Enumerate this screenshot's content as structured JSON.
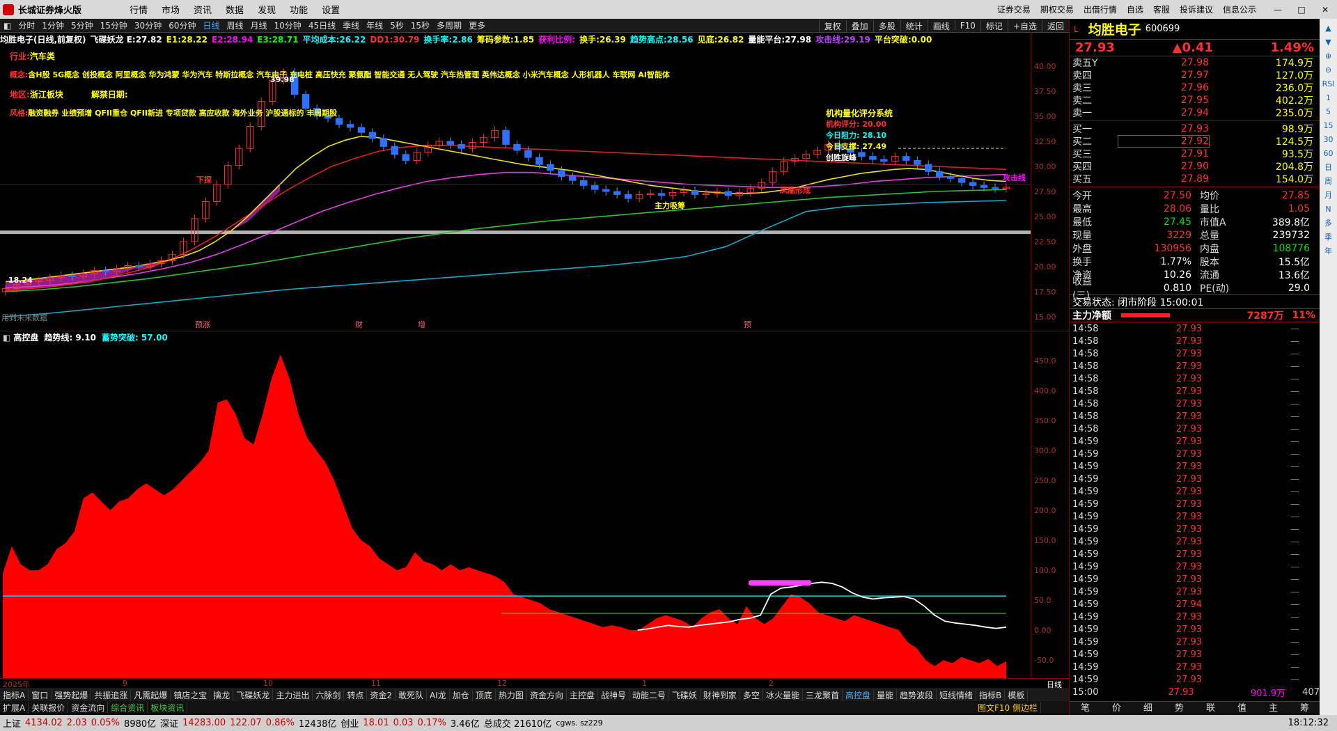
{
  "app": {
    "title": "长城证券烽火版",
    "menu": [
      "行情",
      "市场",
      "资讯",
      "数据",
      "发现",
      "功能",
      "设置"
    ],
    "right_menu": [
      "证券交易",
      "期权交易",
      "出借行情",
      "自选",
      "客服",
      "投诉建议",
      "信息公示"
    ]
  },
  "periods": {
    "items": [
      "分时",
      "1分钟",
      "5分钟",
      "15分钟",
      "30分钟",
      "60分钟",
      "日线",
      "周线",
      "月线",
      "10分钟",
      "45日线",
      "季线",
      "年线",
      "5秒",
      "15秒",
      "多周期",
      "更多"
    ],
    "active": "日线",
    "tools": [
      "复权",
      "叠加",
      "多股",
      "统计",
      "画线",
      "F10",
      "标记",
      "+自选",
      "返回"
    ]
  },
  "main_info": [
    {
      "t": "均胜电子(日线,前复权)",
      "c": "#fff"
    },
    {
      "t": "飞碟妖龙 E:27.82",
      "c": "#fff"
    },
    {
      "t": "E1:28.22",
      "c": "#ff0"
    },
    {
      "t": "E2:28.94",
      "c": "#f0f"
    },
    {
      "t": "E3:28.71",
      "c": "#0f0"
    },
    {
      "t": "平均成本:26.22",
      "c": "#0ff"
    },
    {
      "t": "DD1:30.79",
      "c": "#ff3030"
    },
    {
      "t": "换手率:2.86",
      "c": "#0ff"
    },
    {
      "t": "筹码参数:1.85",
      "c": "#ff0"
    },
    {
      "t": "获利比例:",
      "c": "#f0f"
    },
    {
      "t": "换手:26.39",
      "c": "#ff0"
    },
    {
      "t": "趋势高点:28.56",
      "c": "#0ff"
    },
    {
      "t": "见底:26.82",
      "c": "#ff0"
    },
    {
      "t": "量能平台:27.98",
      "c": "#fff"
    },
    {
      "t": "攻击线:29.19",
      "c": "#c040ff"
    },
    {
      "t": "平台突破:0.00",
      "c": "#ff0"
    }
  ],
  "overlays": {
    "industry": {
      "label": "行业:",
      "value": "汽车类"
    },
    "concept": {
      "label": "概念:",
      "value": "含H股 5G概念 创投概念 阿里概念 华为鸿蒙 华为汽车 特斯拉概念 汽车电子 充电桩 高压快充 聚氨酯 智能交通 无人驾驶 汽车热管理 英伟达概念 小米汽车概念 人形机器人 车联网 AI智能体"
    },
    "region": {
      "label": "地区:",
      "value": "浙江板块",
      "unlock": "解禁日期:"
    },
    "style": {
      "label": "风格:",
      "value": "融资融券 业绩预增 QFII重仓 QFII新进 专项贷款 高应收款 海外业务 沪股通标的 丰周期股"
    },
    "quant_title": "机构量化评分系统",
    "quant_score": "机构评分: 20.00",
    "quant_res": "今日阻力: 28.10",
    "quant_sup": "今日支撑: 27.49",
    "quant_note": "创胜旋峰",
    "label_high": "39.98",
    "label_low": "18.24",
    "label_attack": "攻击线",
    "label_force": "主力吸筹",
    "label_fenglian": "凤凰形成",
    "label_xiatan": "下探",
    "label_fut": "用到未来数据"
  },
  "y_axis_main": [
    "40.00",
    "37.50",
    "35.00",
    "32.50",
    "30.00",
    "27.50",
    "25.00",
    "22.50",
    "20.00",
    "17.50",
    "15.00"
  ],
  "y_axis_sub": [
    "450.0",
    "400.0",
    "350.0",
    "300.0",
    "250.0",
    "200.0",
    "150.0",
    "100.0",
    "50.0",
    "0.00",
    "-50.0"
  ],
  "event_marks": [
    {
      "t": "预涨",
      "x": 280
    },
    {
      "t": "财",
      "x": 510
    },
    {
      "t": "增",
      "x": 600
    },
    {
      "t": "预",
      "x": 1068
    }
  ],
  "sub_info": [
    {
      "t": "高控盘",
      "c": "#fff"
    },
    {
      "t": "趋势线: 9.10",
      "c": "#fff"
    },
    {
      "t": "蓄势突破: 57.00",
      "c": "#0ff"
    }
  ],
  "x_axis": {
    "labels": [
      {
        "t": "2025年",
        "x": 4
      },
      {
        "t": "9",
        "x": 176
      },
      {
        "t": "10",
        "x": 378
      },
      {
        "t": "11",
        "x": 533
      },
      {
        "t": "12",
        "x": 714
      },
      {
        "t": "1",
        "x": 922
      },
      {
        "t": "2",
        "x": 1104
      }
    ],
    "cycle": "日线"
  },
  "indicator_tabs": [
    "指标A",
    "窗口",
    "强势起爆",
    "共振追涨",
    "凡需起爆",
    "镇店之宝",
    "擒龙",
    "飞碟妖龙",
    "主力进出",
    "六脉剑",
    "转点",
    "资金2",
    "敢死队",
    "AI龙",
    "加仓",
    "顶底",
    "热力图",
    "资金方向",
    "主控盘",
    "战神号",
    "动能二号",
    "飞碟妖",
    "财神到家",
    "多空",
    "冰火量能",
    "三龙聚首",
    "高控盘",
    "量能",
    "趋势波段",
    "短线情绪",
    "指标B",
    "模板"
  ],
  "active_tab": "高控盘",
  "bottom_tabs": [
    "扩展A",
    "关联报价",
    "资金流向",
    "综合资讯",
    "板块资讯"
  ],
  "bottom_note": "图文F10 侧边栏",
  "status": {
    "sh_label": "上证",
    "sh": "4134.02",
    "sh_chg": "2.03",
    "sh_pct": "0.05%",
    "sh_amt": "8980亿",
    "sz_label": "深证",
    "sz": "14283.00",
    "sz_chg": "122.07",
    "sz_pct": "0.86%",
    "sz_amt": "12438亿",
    "cy_label": "创业",
    "cy": "18.01",
    "cy_chg": "0.03",
    "cy_pct": "0.17%",
    "cy_amt": "3.46亿",
    "total": "总成交 21610亿",
    "server": "cgws. sz229",
    "clock": "18:12:32"
  },
  "quote": {
    "name": "均胜电子",
    "code": "600699",
    "price": "27.93",
    "change": "▲0.41",
    "pct": "1.49%",
    "asks": [
      {
        "l": "卖五Y",
        "p": "27.98",
        "v": "174.9万"
      },
      {
        "l": "卖四",
        "p": "27.97",
        "v": "127.0万"
      },
      {
        "l": "卖三",
        "p": "27.96",
        "v": "236.0万"
      },
      {
        "l": "卖二",
        "p": "27.95",
        "v": "402.2万"
      },
      {
        "l": "卖一",
        "p": "27.94",
        "v": "235.0万"
      }
    ],
    "bids": [
      {
        "l": "买一",
        "p": "27.93",
        "v": "98.9万"
      },
      {
        "l": "买二",
        "p": "27.92",
        "v": "124.5万"
      },
      {
        "l": "买三",
        "p": "27.91",
        "v": "93.5万"
      },
      {
        "l": "买四",
        "p": "27.90",
        "v": "204.8万"
      },
      {
        "l": "买五",
        "p": "27.89",
        "v": "154.0万"
      }
    ],
    "stats": [
      {
        "a": "今开",
        "b": "27.50",
        "bc": "red",
        "c": "均价",
        "d": "27.85",
        "dc": "red"
      },
      {
        "a": "最高",
        "b": "28.06",
        "bc": "red",
        "c": "量比",
        "d": "1.05",
        "dc": "red"
      },
      {
        "a": "最低",
        "b": "27.45",
        "bc": "grn",
        "c": "市值A",
        "d": "389.8亿",
        "dc": "wht"
      },
      {
        "a": "现量",
        "b": "3229",
        "bc": "red",
        "c": "总量",
        "d": "239732",
        "dc": "wht"
      },
      {
        "a": "外盘",
        "b": "130956",
        "bc": "red",
        "c": "内盘",
        "d": "108776",
        "dc": "grn"
      },
      {
        "a": "换手",
        "b": "1.77%",
        "bc": "wht",
        "c": "股本",
        "d": "15.5亿",
        "dc": "wht"
      },
      {
        "a": "净资",
        "b": "10.26",
        "bc": "wht",
        "c": "流通",
        "d": "13.6亿",
        "dc": "wht"
      },
      {
        "a": "收益(三)",
        "b": "0.810",
        "bc": "wht",
        "c": "PE(动)",
        "d": "29.0",
        "dc": "wht"
      }
    ],
    "trade_state": "交易状态: 闭市阶段 15:00:01",
    "flow_label": "主力净额",
    "flow_value": "7287万",
    "flow_pct": "11%",
    "ticks": [
      {
        "t": "14:58",
        "p": "27.93"
      },
      {
        "t": "14:58",
        "p": "27.93"
      },
      {
        "t": "14:58",
        "p": "27.93"
      },
      {
        "t": "14:58",
        "p": "27.93"
      },
      {
        "t": "14:58",
        "p": "27.93"
      },
      {
        "t": "14:58",
        "p": "27.93"
      },
      {
        "t": "14:58",
        "p": "27.93"
      },
      {
        "t": "14:58",
        "p": "27.93"
      },
      {
        "t": "14:58",
        "p": "27.93"
      },
      {
        "t": "14:59",
        "p": "27.93"
      },
      {
        "t": "14:59",
        "p": "27.93"
      },
      {
        "t": "14:59",
        "p": "27.93"
      },
      {
        "t": "14:59",
        "p": "27.93"
      },
      {
        "t": "14:59",
        "p": "27.93"
      },
      {
        "t": "14:59",
        "p": "27.93"
      },
      {
        "t": "14:59",
        "p": "27.93"
      },
      {
        "t": "14:59",
        "p": "27.93"
      },
      {
        "t": "14:59",
        "p": "27.93"
      },
      {
        "t": "14:59",
        "p": "27.93"
      },
      {
        "t": "14:59",
        "p": "27.93"
      },
      {
        "t": "14:59",
        "p": "27.93"
      },
      {
        "t": "14:59",
        "p": "27.93"
      },
      {
        "t": "14:59",
        "p": "27.94"
      },
      {
        "t": "14:59",
        "p": "27.93"
      },
      {
        "t": "14:59",
        "p": "27.93"
      },
      {
        "t": "14:59",
        "p": "27.93"
      },
      {
        "t": "14:59",
        "p": "27.93"
      },
      {
        "t": "14:59",
        "p": "27.93"
      },
      {
        "t": "14:59",
        "p": "27.93"
      },
      {
        "t": "15:00",
        "p": "27.93",
        "v": "901.9万",
        "n": "407"
      }
    ],
    "tabs": [
      "笔",
      "价",
      "细",
      "势",
      "联",
      "值",
      "主",
      "筹"
    ]
  },
  "sidebar": [
    "▲",
    "▼",
    "⊕",
    "⊖",
    "RSI",
    "1",
    "5",
    "15",
    "30",
    "60",
    "日",
    "周",
    "月",
    "N",
    "多",
    "季",
    "年"
  ],
  "chart_data": [
    {
      "type": "line",
      "name": "K线(日线)",
      "ylim": [
        15,
        41
      ],
      "close": [
        17.8,
        18.2,
        18.5,
        18.6,
        18.9,
        19.1,
        19.0,
        19.3,
        19.6,
        19.5,
        19.8,
        20.1,
        20.0,
        20.3,
        20.6,
        21.2,
        22.5,
        24.8,
        26.5,
        28.2,
        30.1,
        31.8,
        34.0,
        36.5,
        38.6,
        39.4,
        37.2,
        35.8,
        35.1,
        34.8,
        34.2,
        33.9,
        33.4,
        32.8,
        32.0,
        31.2,
        30.6,
        31.4,
        32.1,
        32.5,
        32.2,
        31.8,
        32.4,
        32.9,
        33.6,
        32.2,
        31.6,
        30.9,
        30.2,
        29.6,
        29.0,
        28.6,
        28.1,
        27.7,
        27.5,
        27.2,
        26.8,
        27.2,
        27.3,
        27.1,
        27.4,
        27.6,
        27.2,
        27.3,
        27.5,
        27.1,
        27.4,
        27.8,
        28.4,
        29.5,
        30.5,
        30.8,
        31.2,
        31.6,
        32.2,
        31.8,
        31.4,
        31.0,
        30.7,
        30.5,
        31.0,
        30.6,
        30.2,
        29.5,
        29.0,
        28.8,
        28.4,
        28.1,
        27.9,
        27.8,
        27.93
      ],
      "ma_yellow": [
        18.5,
        18.6,
        18.8,
        19.0,
        19.2,
        19.4,
        19.6,
        19.8,
        20.0,
        20.3,
        20.6,
        21.0,
        21.6,
        22.5,
        23.6,
        25.0,
        26.6,
        28.2,
        29.8,
        31.0,
        32.0,
        32.6,
        33.0,
        32.9,
        32.6,
        32.3,
        32.0,
        31.7,
        31.4,
        31.1,
        30.8,
        30.5,
        30.2,
        30.0,
        29.8,
        29.6,
        29.3,
        29.0,
        28.7,
        28.4,
        28.1,
        27.9,
        27.7,
        27.5,
        27.4,
        27.3,
        27.3,
        27.4,
        27.6,
        27.9,
        28.3,
        28.7,
        29.0,
        29.3,
        29.5,
        29.7,
        29.8,
        29.7,
        29.4,
        29.1,
        28.8,
        28.6,
        28.5
      ],
      "ma_red": [
        17.6,
        17.8,
        18.0,
        18.3,
        18.7,
        19.2,
        19.8,
        20.6,
        21.7,
        23.0,
        24.5,
        26.0,
        27.5,
        28.8,
        30.0,
        30.8,
        31.5,
        31.9,
        32.1,
        32.1,
        32.0,
        31.9,
        31.8,
        31.7,
        31.6,
        31.5,
        31.4,
        31.3,
        31.2,
        31.1,
        31.0,
        30.9,
        30.8,
        30.7,
        30.6,
        30.5,
        30.4,
        30.3,
        30.2,
        30.1,
        30.0,
        29.9,
        29.8,
        29.7
      ],
      "ma_magenta": [
        17.9,
        18.0,
        18.2,
        18.5,
        18.9,
        19.3,
        19.8,
        20.4,
        21.2,
        22.2,
        23.3,
        24.4,
        25.5,
        26.4,
        27.2,
        27.9,
        28.5,
        28.9,
        29.2,
        29.4,
        29.4,
        29.2,
        29.0,
        28.8,
        28.6,
        28.4,
        28.2,
        28.1,
        28.0,
        27.9,
        27.9,
        28.0,
        28.2,
        28.5,
        28.7,
        28.9,
        29.0,
        29.1,
        29.2
      ],
      "ma_green": [
        17.5,
        17.7,
        18.0,
        18.4,
        18.8,
        19.3,
        19.8,
        20.3,
        20.9,
        21.5,
        22.1,
        22.7,
        23.2,
        23.7,
        24.1,
        24.5,
        24.8,
        25.1,
        25.4,
        25.7,
        26.0,
        26.3,
        26.6,
        26.9,
        27.1,
        27.3,
        27.5,
        27.6,
        27.7
      ],
      "ma_cyan": [
        15.0,
        15.3,
        15.7,
        16.1,
        16.5,
        16.9,
        17.3,
        17.7,
        18.0,
        18.3,
        18.6,
        18.9,
        19.2,
        19.5,
        19.8,
        20.1,
        20.5,
        21.0,
        22.0,
        23.8,
        25.5,
        26.0,
        26.2,
        26.4,
        26.5,
        26.6
      ]
    },
    {
      "type": "area",
      "name": "高控盘",
      "ylim": [
        -80,
        480
      ],
      "values": [
        95,
        140,
        110,
        100,
        100,
        110,
        135,
        145,
        165,
        220,
        230,
        215,
        200,
        215,
        220,
        235,
        245,
        235,
        225,
        235,
        250,
        265,
        280,
        300,
        380,
        385,
        360,
        320,
        310,
        360,
        420,
        460,
        420,
        360,
        320,
        300,
        280,
        250,
        210,
        170,
        150,
        140,
        120,
        110,
        100,
        105,
        130,
        115,
        110,
        100,
        110,
        100,
        105,
        100,
        95,
        90,
        80,
        60,
        55,
        50,
        45,
        35,
        30,
        25,
        20,
        15,
        10,
        5,
        8,
        5,
        0,
        0,
        10,
        20,
        25,
        20,
        15,
        5,
        20,
        30,
        35,
        20,
        10,
        40,
        20,
        10,
        20,
        40,
        60,
        55,
        45,
        30,
        25,
        20,
        15,
        25,
        20,
        15,
        10,
        5,
        0,
        -20,
        -30,
        -50,
        -60,
        -50,
        -55,
        -45,
        -50,
        -55,
        -48,
        -60,
        -52
      ],
      "trend_white": [
        null,
        null,
        null,
        null,
        null,
        null,
        null,
        null,
        null,
        null,
        null,
        null,
        null,
        null,
        null,
        null,
        null,
        null,
        null,
        null,
        null,
        null,
        null,
        null,
        null,
        null,
        null,
        null,
        null,
        null,
        null,
        null,
        null,
        null,
        null,
        null,
        null,
        null,
        null,
        null,
        null,
        null,
        null,
        null,
        null,
        null,
        null,
        null,
        null,
        null,
        null,
        null,
        null,
        null,
        null,
        null,
        null,
        null,
        null,
        null,
        null,
        null,
        0,
        2,
        5,
        8,
        6,
        5,
        8,
        10,
        12,
        14,
        18,
        20,
        25,
        60,
        70,
        72,
        75,
        78,
        80,
        78,
        72,
        62,
        55,
        52,
        54,
        55,
        56,
        52,
        40,
        25,
        15,
        12,
        10,
        8,
        5,
        3,
        5
      ],
      "breakout_cyan": 57,
      "zero_green": 28
    }
  ]
}
